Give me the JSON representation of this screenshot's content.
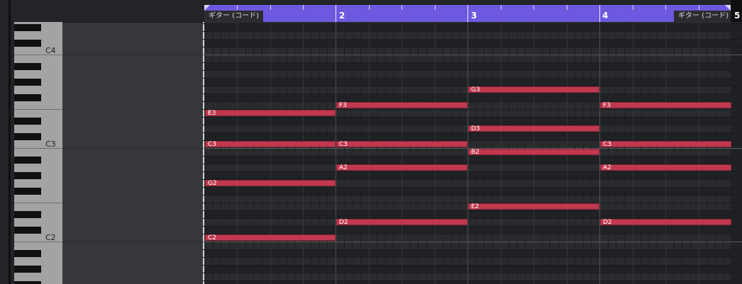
{
  "ruler": {
    "region_label_left": "ギター (コード)",
    "region_label_right": "ギター (コード)",
    "bars": [
      "2",
      "3",
      "4"
    ],
    "end_bar": "5",
    "region_color": "#6c59e0"
  },
  "keyboard": {
    "octave_labels": [
      "C4",
      "C3",
      "C2"
    ]
  },
  "note_color": "#c0394f",
  "notes": [
    {
      "pitch": "E3",
      "bar": 1
    },
    {
      "pitch": "C3",
      "bar": 1
    },
    {
      "pitch": "G2",
      "bar": 1
    },
    {
      "pitch": "C2",
      "bar": 1
    },
    {
      "pitch": "F3",
      "bar": 2
    },
    {
      "pitch": "C3",
      "bar": 2
    },
    {
      "pitch": "A2",
      "bar": 2
    },
    {
      "pitch": "D2",
      "bar": 2
    },
    {
      "pitch": "G3",
      "bar": 3
    },
    {
      "pitch": "D3",
      "bar": 3
    },
    {
      "pitch": "B2",
      "bar": 3
    },
    {
      "pitch": "E2",
      "bar": 3
    },
    {
      "pitch": "F3",
      "bar": 4
    },
    {
      "pitch": "C3",
      "bar": 4
    },
    {
      "pitch": "A2",
      "bar": 4
    },
    {
      "pitch": "D2",
      "bar": 4
    }
  ]
}
